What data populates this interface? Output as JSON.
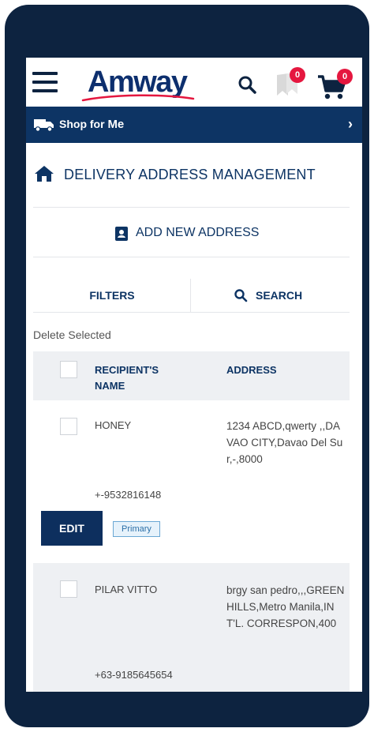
{
  "header": {
    "logo_text": "Amway",
    "fav_badge": "0",
    "cart_badge": "0"
  },
  "shopbar": {
    "label_prefix": "Shop for",
    "label_emphasis": "Me"
  },
  "page": {
    "title": "DELIVERY ADDRESS MANAGEMENT",
    "add_address_label": "ADD NEW ADDRESS",
    "filters_label": "FILTERS",
    "search_label": "SEARCH",
    "delete_selected_label": "Delete Selected"
  },
  "table": {
    "headers": {
      "recipient_line1": "RECIPIENT'S",
      "recipient_line2": "NAME",
      "address": "ADDRESS"
    },
    "rows": [
      {
        "name": "HONEY",
        "address": "1234 ABCD,qwerty ,,DAVAO CITY,Davao Del Sur,-,8000",
        "phone": "+-9532816148",
        "edit_label": "EDIT",
        "tag": "Primary"
      },
      {
        "name": "PILAR VITTO",
        "address": "brgy san pedro,,,GREENHILLS,Metro Manila,INT'L. CORRESPON,400",
        "phone": "+63-9185645654"
      }
    ]
  },
  "colors": {
    "navy": "#0d2340",
    "brand_blue": "#0d3464",
    "badge_red": "#e5173f",
    "row_alt_bg": "#eef0f3"
  }
}
